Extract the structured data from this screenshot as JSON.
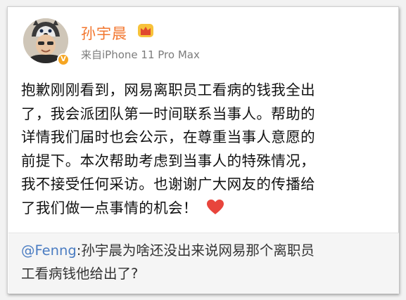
{
  "post": {
    "username": "孙宇晨",
    "source": "来自iPhone 11 Pro Max",
    "body_lines": [
      "抱歉刚刚看到，网易离职员工看病的钱我全出",
      "了，我会派团队第一时间联系当事人。帮助的",
      "详情我们届时也会公示，在尊重当事人意愿的",
      "前提下。本次帮助考虑到当事人的特殊情况，",
      "我不接受任何采访。也谢谢广大网友的传播给",
      "了我们做一点事情的机会！"
    ]
  },
  "repost": {
    "mention": "@Fenng",
    "text_line1": ":孙宇晨为啥还没出来说网易那个离职员",
    "text_line2": "工看病钱他给出了?"
  },
  "icons": {
    "avatar": "user-avatar",
    "verified": "verified-badge-icon",
    "crown": "crown-icon",
    "heart": "heart-icon"
  },
  "colors": {
    "username": "#f2762e",
    "mention": "#4a7cc2",
    "heart": "#e8453c",
    "verified": "#f6a623"
  }
}
